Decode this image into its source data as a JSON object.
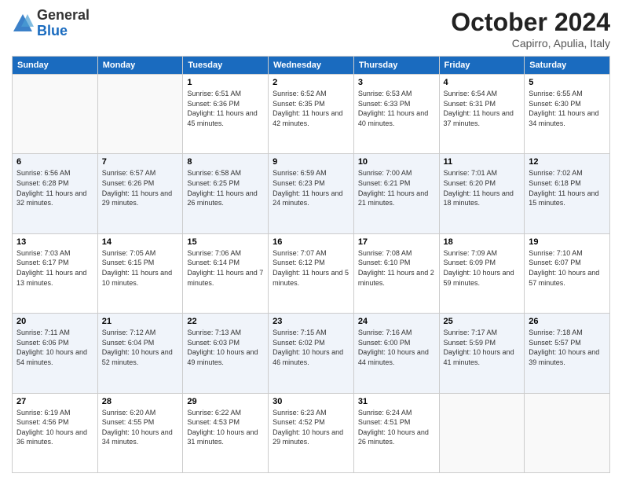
{
  "header": {
    "logo_general": "General",
    "logo_blue": "Blue",
    "month": "October 2024",
    "location": "Capirro, Apulia, Italy"
  },
  "weekdays": [
    "Sunday",
    "Monday",
    "Tuesday",
    "Wednesday",
    "Thursday",
    "Friday",
    "Saturday"
  ],
  "weeks": [
    [
      {
        "day": "",
        "sunrise": "",
        "sunset": "",
        "daylight": ""
      },
      {
        "day": "",
        "sunrise": "",
        "sunset": "",
        "daylight": ""
      },
      {
        "day": "1",
        "sunrise": "Sunrise: 6:51 AM",
        "sunset": "Sunset: 6:36 PM",
        "daylight": "Daylight: 11 hours and 45 minutes."
      },
      {
        "day": "2",
        "sunrise": "Sunrise: 6:52 AM",
        "sunset": "Sunset: 6:35 PM",
        "daylight": "Daylight: 11 hours and 42 minutes."
      },
      {
        "day": "3",
        "sunrise": "Sunrise: 6:53 AM",
        "sunset": "Sunset: 6:33 PM",
        "daylight": "Daylight: 11 hours and 40 minutes."
      },
      {
        "day": "4",
        "sunrise": "Sunrise: 6:54 AM",
        "sunset": "Sunset: 6:31 PM",
        "daylight": "Daylight: 11 hours and 37 minutes."
      },
      {
        "day": "5",
        "sunrise": "Sunrise: 6:55 AM",
        "sunset": "Sunset: 6:30 PM",
        "daylight": "Daylight: 11 hours and 34 minutes."
      }
    ],
    [
      {
        "day": "6",
        "sunrise": "Sunrise: 6:56 AM",
        "sunset": "Sunset: 6:28 PM",
        "daylight": "Daylight: 11 hours and 32 minutes."
      },
      {
        "day": "7",
        "sunrise": "Sunrise: 6:57 AM",
        "sunset": "Sunset: 6:26 PM",
        "daylight": "Daylight: 11 hours and 29 minutes."
      },
      {
        "day": "8",
        "sunrise": "Sunrise: 6:58 AM",
        "sunset": "Sunset: 6:25 PM",
        "daylight": "Daylight: 11 hours and 26 minutes."
      },
      {
        "day": "9",
        "sunrise": "Sunrise: 6:59 AM",
        "sunset": "Sunset: 6:23 PM",
        "daylight": "Daylight: 11 hours and 24 minutes."
      },
      {
        "day": "10",
        "sunrise": "Sunrise: 7:00 AM",
        "sunset": "Sunset: 6:21 PM",
        "daylight": "Daylight: 11 hours and 21 minutes."
      },
      {
        "day": "11",
        "sunrise": "Sunrise: 7:01 AM",
        "sunset": "Sunset: 6:20 PM",
        "daylight": "Daylight: 11 hours and 18 minutes."
      },
      {
        "day": "12",
        "sunrise": "Sunrise: 7:02 AM",
        "sunset": "Sunset: 6:18 PM",
        "daylight": "Daylight: 11 hours and 15 minutes."
      }
    ],
    [
      {
        "day": "13",
        "sunrise": "Sunrise: 7:03 AM",
        "sunset": "Sunset: 6:17 PM",
        "daylight": "Daylight: 11 hours and 13 minutes."
      },
      {
        "day": "14",
        "sunrise": "Sunrise: 7:05 AM",
        "sunset": "Sunset: 6:15 PM",
        "daylight": "Daylight: 11 hours and 10 minutes."
      },
      {
        "day": "15",
        "sunrise": "Sunrise: 7:06 AM",
        "sunset": "Sunset: 6:14 PM",
        "daylight": "Daylight: 11 hours and 7 minutes."
      },
      {
        "day": "16",
        "sunrise": "Sunrise: 7:07 AM",
        "sunset": "Sunset: 6:12 PM",
        "daylight": "Daylight: 11 hours and 5 minutes."
      },
      {
        "day": "17",
        "sunrise": "Sunrise: 7:08 AM",
        "sunset": "Sunset: 6:10 PM",
        "daylight": "Daylight: 11 hours and 2 minutes."
      },
      {
        "day": "18",
        "sunrise": "Sunrise: 7:09 AM",
        "sunset": "Sunset: 6:09 PM",
        "daylight": "Daylight: 10 hours and 59 minutes."
      },
      {
        "day": "19",
        "sunrise": "Sunrise: 7:10 AM",
        "sunset": "Sunset: 6:07 PM",
        "daylight": "Daylight: 10 hours and 57 minutes."
      }
    ],
    [
      {
        "day": "20",
        "sunrise": "Sunrise: 7:11 AM",
        "sunset": "Sunset: 6:06 PM",
        "daylight": "Daylight: 10 hours and 54 minutes."
      },
      {
        "day": "21",
        "sunrise": "Sunrise: 7:12 AM",
        "sunset": "Sunset: 6:04 PM",
        "daylight": "Daylight: 10 hours and 52 minutes."
      },
      {
        "day": "22",
        "sunrise": "Sunrise: 7:13 AM",
        "sunset": "Sunset: 6:03 PM",
        "daylight": "Daylight: 10 hours and 49 minutes."
      },
      {
        "day": "23",
        "sunrise": "Sunrise: 7:15 AM",
        "sunset": "Sunset: 6:02 PM",
        "daylight": "Daylight: 10 hours and 46 minutes."
      },
      {
        "day": "24",
        "sunrise": "Sunrise: 7:16 AM",
        "sunset": "Sunset: 6:00 PM",
        "daylight": "Daylight: 10 hours and 44 minutes."
      },
      {
        "day": "25",
        "sunrise": "Sunrise: 7:17 AM",
        "sunset": "Sunset: 5:59 PM",
        "daylight": "Daylight: 10 hours and 41 minutes."
      },
      {
        "day": "26",
        "sunrise": "Sunrise: 7:18 AM",
        "sunset": "Sunset: 5:57 PM",
        "daylight": "Daylight: 10 hours and 39 minutes."
      }
    ],
    [
      {
        "day": "27",
        "sunrise": "Sunrise: 6:19 AM",
        "sunset": "Sunset: 4:56 PM",
        "daylight": "Daylight: 10 hours and 36 minutes."
      },
      {
        "day": "28",
        "sunrise": "Sunrise: 6:20 AM",
        "sunset": "Sunset: 4:55 PM",
        "daylight": "Daylight: 10 hours and 34 minutes."
      },
      {
        "day": "29",
        "sunrise": "Sunrise: 6:22 AM",
        "sunset": "Sunset: 4:53 PM",
        "daylight": "Daylight: 10 hours and 31 minutes."
      },
      {
        "day": "30",
        "sunrise": "Sunrise: 6:23 AM",
        "sunset": "Sunset: 4:52 PM",
        "daylight": "Daylight: 10 hours and 29 minutes."
      },
      {
        "day": "31",
        "sunrise": "Sunrise: 6:24 AM",
        "sunset": "Sunset: 4:51 PM",
        "daylight": "Daylight: 10 hours and 26 minutes."
      },
      {
        "day": "",
        "sunrise": "",
        "sunset": "",
        "daylight": ""
      },
      {
        "day": "",
        "sunrise": "",
        "sunset": "",
        "daylight": ""
      }
    ]
  ]
}
